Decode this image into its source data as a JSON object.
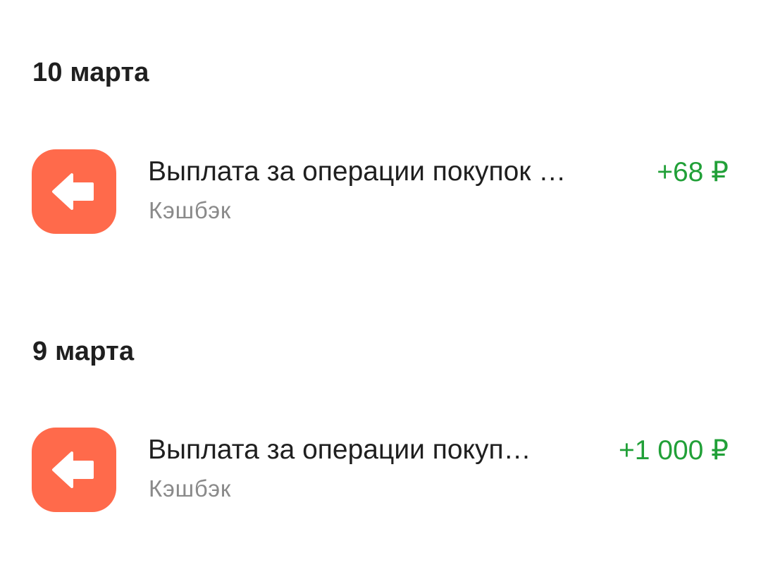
{
  "colors": {
    "icon_bg": "#ff6a4b",
    "amount_positive": "#21a038",
    "subtitle": "#8a8a8a",
    "text": "#1f1f1f"
  },
  "groups": [
    {
      "date": "10 марта",
      "transactions": [
        {
          "icon": "arrow-left-icon",
          "title": "Выплата за операции покупок …",
          "category": "Кэшбэк",
          "amount": "+68 ₽"
        }
      ]
    },
    {
      "date": "9 марта",
      "transactions": [
        {
          "icon": "arrow-left-icon",
          "title": "Выплата за операции покуп…",
          "category": "Кэшбэк",
          "amount": "+1 000 ₽"
        }
      ]
    }
  ]
}
